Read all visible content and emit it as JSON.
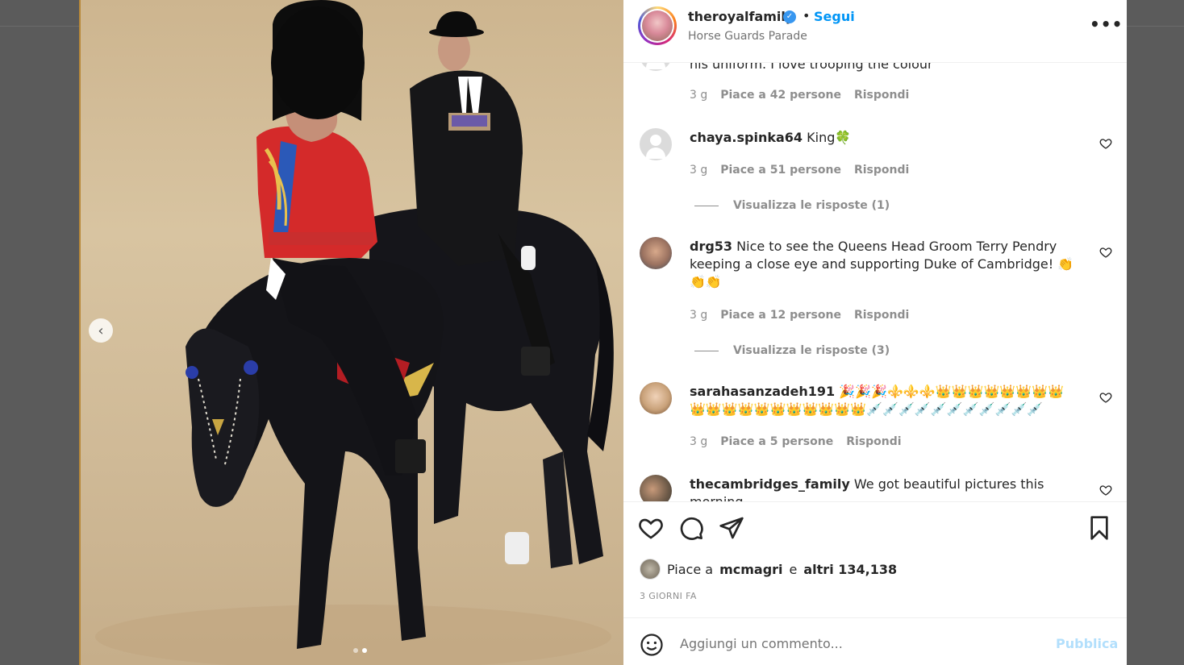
{
  "post": {
    "username": "theroyalfamily",
    "separator": "•",
    "follow_label": "Segui",
    "location": "Horse Guards Parade",
    "more_label": "•••"
  },
  "photo": {
    "carousel_prev": "‹",
    "slides": 2,
    "active_slide": 2
  },
  "comments": {
    "partial_text": "his uniform. I love trooping the colour",
    "partial_meta": {
      "time": "3 g",
      "likes": "Piace a 42 persone",
      "reply": "Rispondi"
    },
    "items": [
      {
        "user": "chaya.spinka64",
        "text": "King🍀",
        "time": "3 g",
        "likes": "Piace a 51 persone",
        "reply": "Rispondi",
        "view_replies": "Visualizza le risposte (1)"
      },
      {
        "user": "drg53",
        "text": "Nice to see the Queens Head Groom Terry Pendry keeping a close eye and supporting Duke of Cambridge! 👏👏👏",
        "time": "3 g",
        "likes": "Piace a 12 persone",
        "reply": "Rispondi",
        "view_replies": "Visualizza le risposte (3)"
      },
      {
        "user": "sarahasanzadeh191",
        "text": "🎉🎉🎉⚜️⚜️⚜️👑👑👑👑👑👑👑👑👑👑👑👑👑👑👑👑👑👑👑💉💉💉💉💉💉💉💉💉💉💉",
        "time": "3 g",
        "likes": "Piace a 5 persone",
        "reply": "Rispondi"
      },
      {
        "user": "thecambridges_family",
        "text": "We got beautiful pictures this morning"
      }
    ]
  },
  "actions": {
    "like_icon": "heart-icon",
    "comment_icon": "comment-icon",
    "share_icon": "paper-plane-icon",
    "save_icon": "bookmark-icon",
    "likes_prefix": "Piace a",
    "likes_user": "mcmagri",
    "likes_mid": "e",
    "likes_rest": "altri 134,138",
    "time_ago": "3 GIORNI FA"
  },
  "comment_box": {
    "placeholder": "Aggiungi un commento...",
    "publish_label": "Pubblica"
  },
  "colors": {
    "link": "#0095f6",
    "publish_disabled": "#b2dffc",
    "secondary_text": "#8e8e8e"
  }
}
